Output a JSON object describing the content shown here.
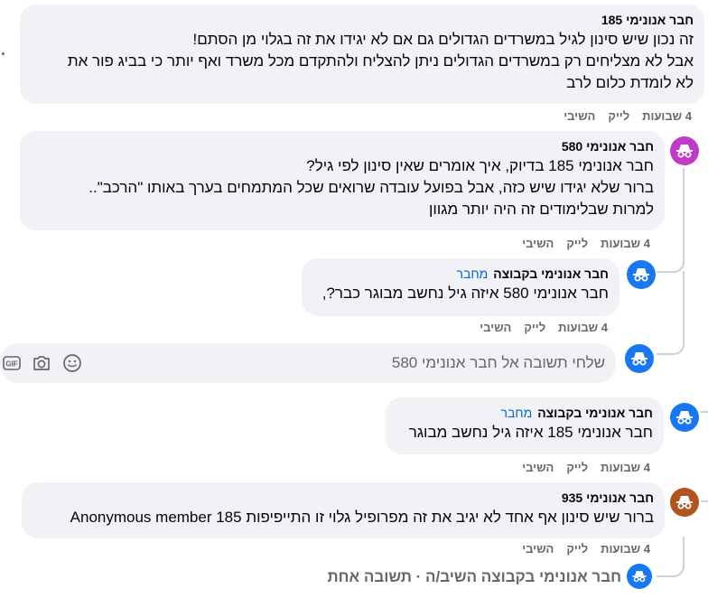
{
  "comments": [
    {
      "id": "c1",
      "author": "חבר אנונימי 185",
      "lines": [
        "זה נכון שיש סינון לגיל במשרדים הגדולים גם אם לא יגידו את זה בגלוי מן הסתם!",
        "אבל לא מצליחים רק במשרדים הגדולים ניתן להצליח ולהתקדם מכל משרד ואף יותר כי בביג פור את",
        "לא לומדת כלום לרב"
      ],
      "time": "4 שבועות",
      "like": "לייק",
      "reply": "השיבי"
    },
    {
      "id": "c2",
      "author": "חבר אנונימי 580",
      "lines": [
        "חבר אנונימי 185 בדיוק, איך אומרים שאין סינון לפי גיל?",
        "ברור שלא יגידו שיש כזה, אבל בפועל עובדה שרואים שכל המתמחים בערך באותו \"הרכב\"..",
        "למרות שבלימודים זה היה יותר מגוון"
      ],
      "time": "4 שבועות",
      "like": "לייק",
      "reply": "השיבי"
    },
    {
      "id": "c3",
      "author": "חבר אנונימי בקבוצה",
      "badge": "מחבר",
      "lines": [
        "חבר אנונימי 580 איזה גיל נחשב מבוגר כבר?,"
      ],
      "time": "4 שבועות",
      "like": "לייק",
      "reply": "השיבי"
    },
    {
      "id": "c4",
      "author": "חבר אנונימי בקבוצה",
      "badge": "מחבר",
      "lines": [
        "חבר אנונימי 185 איזה גיל נחשב מבוגר"
      ],
      "time": "4 שבועות",
      "like": "לייק",
      "reply": "השיבי"
    },
    {
      "id": "c5",
      "author": "חבר אנונימי 935",
      "lines": [
        "ברור שיש סינון אף אחד לא יגיב את זה מפרופיל גלוי זו התייפיפות Anonymous member 185"
      ],
      "time": "4 שבועות",
      "like": "לייק",
      "reply": "השיבי"
    }
  ],
  "reply_input": {
    "placeholder": "שלחי תשובה אל חבר אנונימי 580"
  },
  "view_replies": "חבר אנונימי בקבוצה השיב/ה · תשובה אחת",
  "icons": {
    "avatar": "incognito-icon",
    "emoji": "smiley-icon",
    "camera": "camera-icon",
    "gif": "gif-icon"
  },
  "colors": {
    "bubble": "#f0f2f5",
    "badge": "#0064d1",
    "secondary": "#65676b",
    "avatar_blue": "#1877f2",
    "avatar_pink": "#c13bc6",
    "avatar_orange": "#b2541f"
  }
}
